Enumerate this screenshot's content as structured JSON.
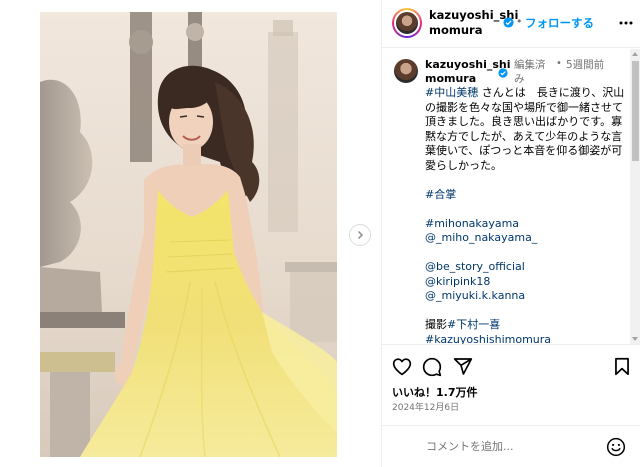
{
  "post": {
    "username": "kazuyoshi_shimomura",
    "follow_label": "フォローする",
    "header_dot": "•",
    "media_alt": "黄色いドレスの女性"
  },
  "caption": {
    "username": "kazuyoshi_shimomura",
    "edited_label": "編集済み",
    "meta_dot": "•",
    "time_ago": "5週間前",
    "line_intro_tag": "#中山美穂",
    "line_intro_text": " さんとは　長きに渡り、沢山の撮影を色々な国や場所で御一緒させて頂きました。良き思い出ばかりです。寡黙な方でしたが、あえて少年のような言葉使いで、ぽつっと本音を仰る御姿が可愛らしかった。",
    "tag_gassho": "#合掌",
    "tag_mihonakayama": "#mihonakayama",
    "mention_miho": "@_miho_nakayama_",
    "mention_bestory": "@be_story_official",
    "mention_kiripink": "@kiripink18",
    "mention_miyuki": "@_miyuki.k.kanna",
    "photo_credit_prefix": "撮影",
    "photo_credit_tag": "#下村一喜",
    "tag_kazuyoshishimomura": "#kazuyoshishimomura"
  },
  "actions": {
    "likes": "いいね！1.7万件",
    "date": "2024年12月6日"
  },
  "comment_form": {
    "placeholder": "コメントを追加..."
  },
  "icons": {
    "verified": "verified-badge-icon",
    "more": "more-options-icon",
    "like": "heart-icon",
    "comment": "comment-icon",
    "share": "share-icon",
    "save": "bookmark-icon",
    "emoji": "emoji-icon",
    "carousel_next": "chevron-right-icon"
  },
  "colors": {
    "accent": "#0095f6",
    "link": "#00376b",
    "verified": "#0095f6",
    "muted": "#737373"
  }
}
